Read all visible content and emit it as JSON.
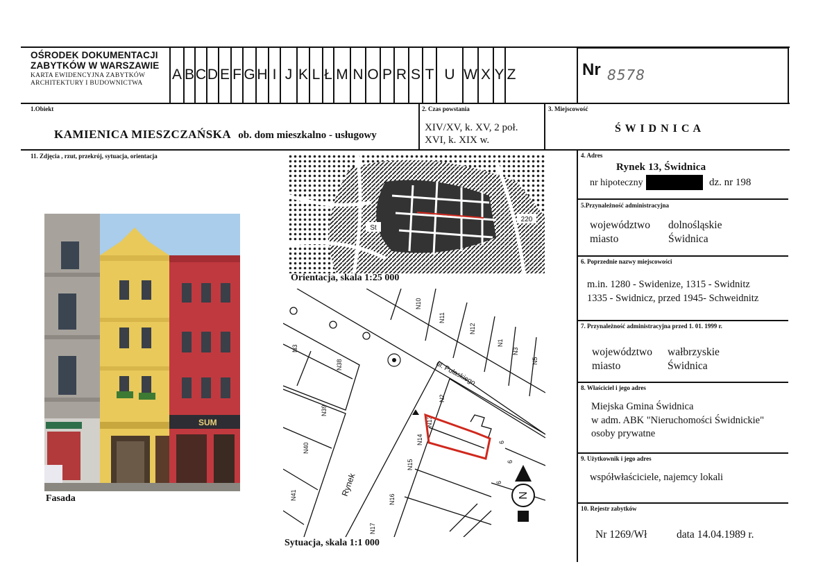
{
  "header": {
    "org_line1": "OŚRODEK DOKUMENTACJI",
    "org_line2": "ZABYTKÓW W WARSZAWIE",
    "org_line3": "KARTA EWIDENCYJNA ZABYTKÓW",
    "org_line4": "ARCHITEKTURY I BUDOWNICTWA",
    "letters": [
      "A",
      "B",
      "C",
      "D",
      "E",
      "F",
      "G",
      "H",
      "I",
      "J",
      "K",
      "L",
      "Ł",
      "M",
      "N",
      "O",
      "P",
      "R",
      "S",
      "T",
      "U",
      "W",
      "X",
      "Y",
      "Z"
    ],
    "nr_label": "Nr",
    "nr_value": "8578"
  },
  "obiekt": {
    "label": "1.Obiekt",
    "name": "KAMIENICA MIESZCZAŃSKA",
    "desc": "ob. dom mieszkalno - usługowy"
  },
  "czas": {
    "label": "2. Czas powstania",
    "line1": "XIV/XV,  k. XV, 2 poł.",
    "line2": "XVI,   k. XIX w."
  },
  "miejscowosc": {
    "label": "3.   Miejscowość",
    "value": "Ś W I D N I C A"
  },
  "photos": {
    "label": "11.  Zdjęcia , rzut, przekrój, sytuacja, orientacja",
    "fasada": "Fasada",
    "orientacja": "Orientacja, skala 1:25 000",
    "sytuacja": "Sytuacja, skala 1:1 000",
    "shop_sign": "SUM"
  },
  "map_labels": {
    "street": "ul. Pułaskiego",
    "rynek": "Rynek",
    "map_number": "220",
    "st_label": "St",
    "plots": [
      "N10",
      "N11",
      "N12",
      "N1",
      "N3",
      "N5",
      "N3",
      "N38",
      "N39",
      "N40",
      "N41",
      "N2",
      "N13",
      "N14",
      "N15",
      "N16",
      "N17",
      "6",
      "6",
      "6"
    ],
    "north": "N"
  },
  "adres": {
    "label": "4. Adres",
    "value": "Rynek 13, Świdnica",
    "hip_label": "nr hipoteczny",
    "dz": "dz. nr 198"
  },
  "przynaleznosc": {
    "label": "5.Przynależność administracyjna",
    "woj_key": "województwo",
    "woj_val": "dolnośląskie",
    "miasto_key": "miasto",
    "miasto_val": "Świdnica"
  },
  "poprzednie": {
    "label": "6. Poprzednie nazwy miejscowości",
    "line1": "m.in.  1280 - Swidenize,  1315 - Swidnitz",
    "line2": "1335 - Swidnicz,  przed 1945- Schweidnitz"
  },
  "przynaleznosc_1999": {
    "label": "7. Przynależność administracyjna  przed 1. 01. 1999 r.",
    "woj_key": "województwo",
    "woj_val": "wałbrzyskie",
    "miasto_key": "miasto",
    "miasto_val": "Świdnica"
  },
  "wlasciciel": {
    "label": "8. Właściciel i jego adres",
    "line1": "Miejska Gmina Świdnica",
    "line2": "w adm. ABK \"Nieruchomości Świdnickie\"",
    "line3": "osoby prywatne"
  },
  "uzytkownik": {
    "label": "9. Użytkownik i jego adres",
    "value": "współwłaściciele, najemcy lokali"
  },
  "rejestr": {
    "label": "10. Rejestr zabytków",
    "nr": "Nr  1269/Wł",
    "data": "data  14.04.1989 r."
  },
  "colors": {
    "ink": "#111111",
    "highlight_red": "#d0281d",
    "facade_yellow": "#e8c95a",
    "facade_red": "#c0393f",
    "sky": "#7fb6e0"
  }
}
